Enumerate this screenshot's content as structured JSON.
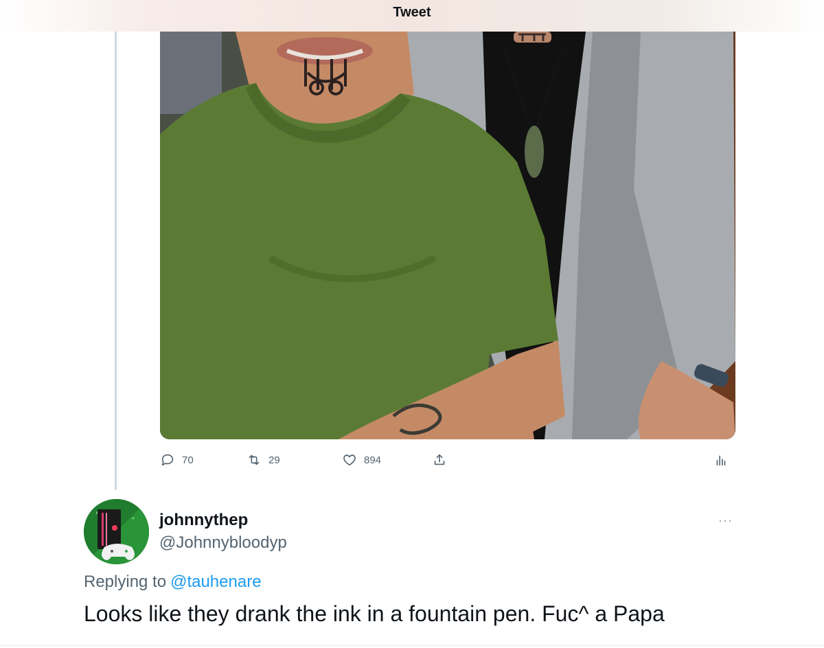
{
  "header": {
    "title": "Tweet"
  },
  "media": {
    "alt": ""
  },
  "actions": {
    "reply": {
      "icon": "reply-icon",
      "count": "70"
    },
    "retweet": {
      "icon": "retweet-icon",
      "count": "29"
    },
    "like": {
      "icon": "heart-icon",
      "count": "894"
    },
    "share": {
      "icon": "share-icon"
    },
    "analytics": {
      "icon": "analytics-icon"
    }
  },
  "reply_tweet": {
    "display_name": "johnnythep",
    "handle": "@Johnnybloodyp",
    "more": "···",
    "replying_to_label": "Replying to",
    "replying_to_handle": "@tauhenare",
    "text": "Looks like they drank the ink in a fountain pen. Fuc^ a Papa"
  },
  "colors": {
    "accent": "#1d9bf0",
    "secondary_text": "#536471",
    "primary_text": "#0f1419",
    "thread_line": "#cfd9de"
  }
}
